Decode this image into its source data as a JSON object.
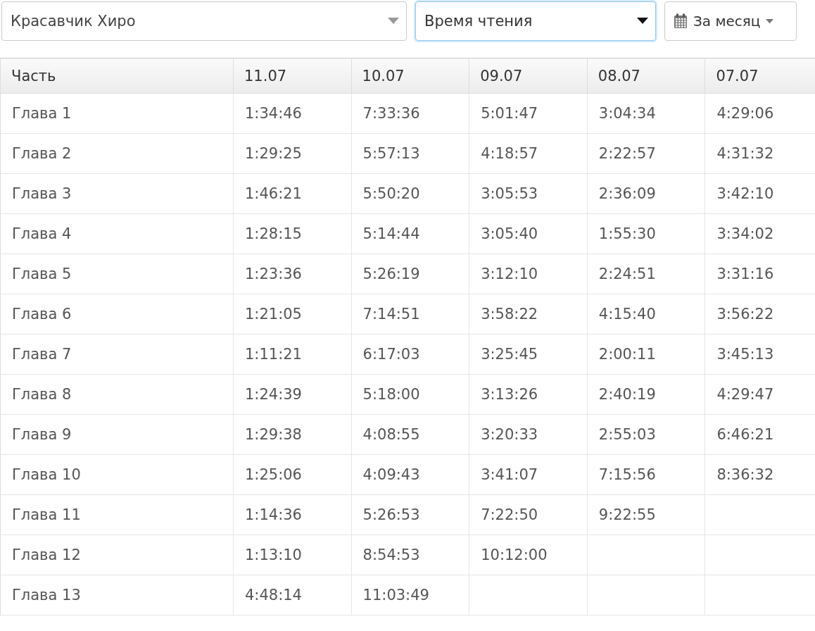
{
  "filters": [
    {
      "kind": "select",
      "value": "Красавчик Хиро",
      "focused": false
    },
    {
      "kind": "select",
      "value": "Время чтения",
      "focused": true
    },
    {
      "kind": "period",
      "value": "За месяц"
    }
  ],
  "table": {
    "columns": [
      "Часть",
      "11.07",
      "10.07",
      "09.07",
      "08.07",
      "07.07"
    ],
    "rows": [
      [
        "Глава 1",
        "1:34:46",
        "7:33:36",
        "5:01:47",
        "3:04:34",
        "4:29:06"
      ],
      [
        "Глава 2",
        "1:29:25",
        "5:57:13",
        "4:18:57",
        "2:22:57",
        "4:31:32"
      ],
      [
        "Глава 3",
        "1:46:21",
        "5:50:20",
        "3:05:53",
        "2:36:09",
        "3:42:10"
      ],
      [
        "Глава 4",
        "1:28:15",
        "5:14:44",
        "3:05:40",
        "1:55:30",
        "3:34:02"
      ],
      [
        "Глава 5",
        "1:23:36",
        "5:26:19",
        "3:12:10",
        "2:24:51",
        "3:31:16"
      ],
      [
        "Глава 6",
        "1:21:05",
        "7:14:51",
        "3:58:22",
        "4:15:40",
        "3:56:22"
      ],
      [
        "Глава 7",
        "1:11:21",
        "6:17:03",
        "3:25:45",
        "2:00:11",
        "3:45:13"
      ],
      [
        "Глава 8",
        "1:24:39",
        "5:18:00",
        "3:13:26",
        "2:40:19",
        "4:29:47"
      ],
      [
        "Глава 9",
        "1:29:38",
        "4:08:55",
        "3:20:33",
        "2:55:03",
        "6:46:21"
      ],
      [
        "Глава 10",
        "1:25:06",
        "4:09:43",
        "3:41:07",
        "7:15:56",
        "8:36:32"
      ],
      [
        "Глава 11",
        "1:14:36",
        "5:26:53",
        "7:22:50",
        "9:22:55"
      ],
      [
        "Глава 12",
        "1:13:10",
        "8:54:53",
        "10:12:00"
      ],
      [
        "Глава 13",
        "4:48:14",
        "11:03:49"
      ]
    ]
  }
}
